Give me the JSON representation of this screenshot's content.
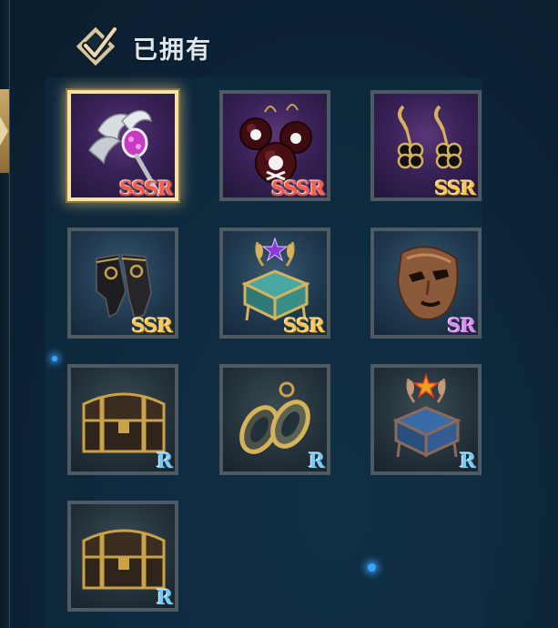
{
  "header": {
    "title": "已拥有"
  },
  "items": [
    {
      "name": "silver-wing-scepter",
      "rarity": "SSSR",
      "bg": "purple",
      "selected": true
    },
    {
      "name": "skull-bomb-earrings",
      "rarity": "SSSR",
      "bg": "purple",
      "selected": false
    },
    {
      "name": "clover-earrings",
      "rarity": "SSR",
      "bg": "purple",
      "selected": false
    },
    {
      "name": "black-gloves",
      "rarity": "SSR",
      "bg": "blue",
      "selected": false
    },
    {
      "name": "laurel-jewel-box",
      "rarity": "SSR",
      "bg": "blue",
      "selected": false
    },
    {
      "name": "bronze-mask",
      "rarity": "SR",
      "bg": "blue",
      "selected": false
    },
    {
      "name": "treasure-chest",
      "rarity": "R",
      "bg": "dark",
      "selected": false
    },
    {
      "name": "hoop-earrings",
      "rarity": "R",
      "bg": "dark",
      "selected": false
    },
    {
      "name": "laurel-jewel-box-blue",
      "rarity": "R",
      "bg": "dark",
      "selected": false
    },
    {
      "name": "treasure-chest",
      "rarity": "R",
      "bg": "dark",
      "selected": false
    }
  ],
  "colors": {
    "selected_border": "#f5e3a6",
    "ssr_red": "#ff5a4a",
    "ssr_gold": "#f6c65a",
    "sr": "#d88ef0",
    "r": "#7ccaf2"
  }
}
